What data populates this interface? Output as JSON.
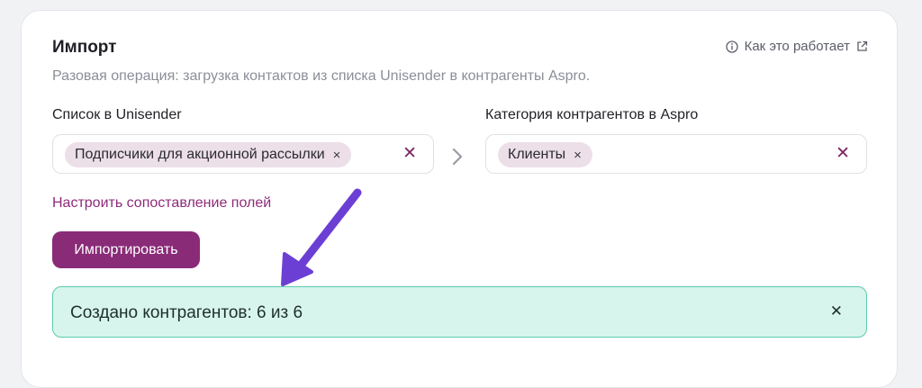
{
  "import_section": {
    "title": "Импорт",
    "help_link": "Как это работает",
    "subtitle": "Разовая операция: загрузка контактов из списка Unisender в контрагенты Aspro."
  },
  "source_field": {
    "label": "Список в Unisender",
    "selected_chip": "Подписчики для акционной рассылки"
  },
  "target_field": {
    "label": "Категория контрагентов в Aspro",
    "selected_chip": "Клиенты"
  },
  "field_mapping_link": "Настроить сопоставление полей",
  "import_button": "Импортировать",
  "result_alert": {
    "message": "Создано контрагентов: 6 из 6"
  },
  "icons": {
    "chip_remove": "×",
    "clear": "✕",
    "alert_close": "✕"
  },
  "colors": {
    "accent": "#8a2b78",
    "chip_bg": "#ecdfe8",
    "alert_bg": "#d7f5ec",
    "alert_border": "#5dc9ad",
    "annotation_arrow": "#6c3fd4"
  }
}
